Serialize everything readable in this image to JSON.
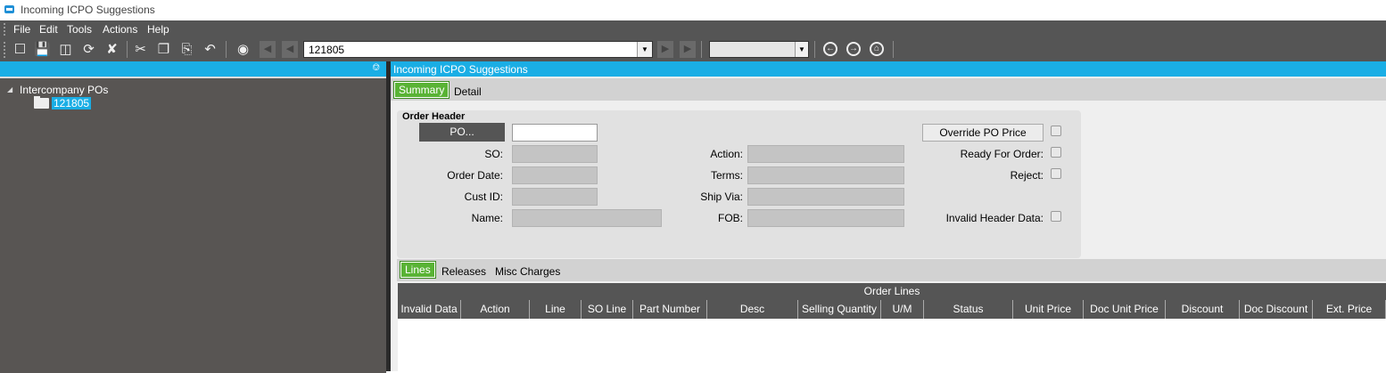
{
  "window": {
    "title": "Incoming ICPO Suggestions"
  },
  "menu": [
    "File",
    "Edit",
    "Tools",
    "Actions",
    "Help"
  ],
  "toolbar": {
    "icons": [
      "new-icon",
      "save-icon",
      "delete-icon",
      "refresh-icon",
      "clear-icon",
      "cut-icon",
      "copy-icon",
      "paste-icon",
      "undo-icon",
      "search-icon",
      "first-record-icon",
      "prev-record-icon",
      "next-record-icon",
      "last-record-icon",
      "back-icon",
      "forward-icon",
      "home-icon"
    ],
    "key_value": "121805",
    "secondary_value": ""
  },
  "tree": {
    "root": "Intercompany POs",
    "selected": "121805"
  },
  "panel": {
    "title": "Incoming ICPO Suggestions"
  },
  "tabs_top": {
    "summary": "Summary",
    "detail": "Detail",
    "active": "Summary"
  },
  "order_header": {
    "title": "Order Header",
    "po_button": "PO...",
    "po_value": "",
    "labels": {
      "so": "SO:",
      "order_date": "Order Date:",
      "cust_id": "Cust ID:",
      "name": "Name:",
      "action": "Action:",
      "terms": "Terms:",
      "ship_via": "Ship Via:",
      "fob": "FOB:",
      "ready_for_order": "Ready For Order:",
      "reject": "Reject:",
      "invalid_header_data": "Invalid Header Data:"
    },
    "override_button": "Override PO Price",
    "checkboxes": {
      "override": false,
      "ready_for_order": false,
      "reject": false,
      "invalid_header_data": false
    }
  },
  "tabs_bottom": {
    "lines": "Lines",
    "releases": "Releases",
    "misc": "Misc Charges",
    "active": "Lines"
  },
  "grid": {
    "title": "Order Lines",
    "columns": [
      "Invalid Data",
      "Action",
      "Line",
      "SO Line",
      "Part Number",
      "Desc",
      "Selling Quantity",
      "U/M",
      "Status",
      "Unit Price",
      "Doc Unit Price",
      "Discount",
      "Doc Discount",
      "Ext. Price"
    ],
    "rows": []
  },
  "colors": {
    "accent": "#1aaee5",
    "tab_active": "#59b335",
    "chrome": "#555555"
  }
}
